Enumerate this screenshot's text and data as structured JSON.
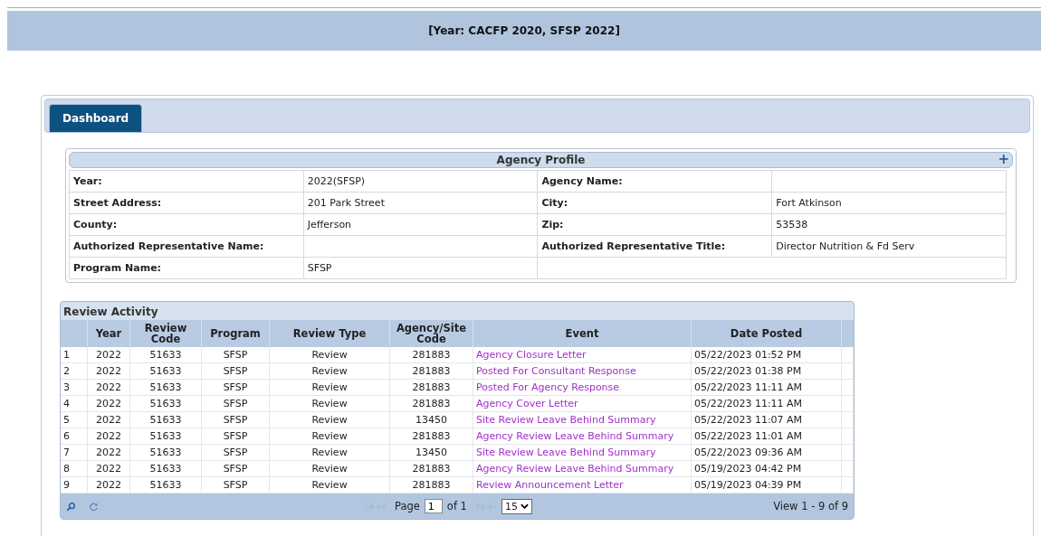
{
  "header": {
    "year_text": "[Year: CACFP 2020, SFSP 2022]"
  },
  "tabs": [
    {
      "label": "Dashboard",
      "selected": true
    }
  ],
  "agency_profile": {
    "title": "Agency Profile",
    "expand_icon": "+",
    "rows": [
      {
        "cells": [
          {
            "label": "Year:",
            "value": "2022(SFSP)"
          },
          {
            "label": "Agency Name:"
          }
        ]
      },
      {
        "cells": [
          {
            "label": "Street Address:",
            "value": "201 Park Street"
          },
          {
            "label": "City:",
            "value": "Fort Atkinson"
          }
        ]
      },
      {
        "cells": [
          {
            "label": "County:",
            "value": "Jefferson"
          },
          {
            "label": "Zip:",
            "value": "53538"
          }
        ]
      },
      {
        "cells": [
          {
            "label": "Authorized Representative Name:"
          },
          {
            "label": "Authorized Representative Title:",
            "value": "Director Nutrition & Fd Serv"
          }
        ]
      },
      {
        "cells": [
          {
            "label": "Program Name:",
            "value": "SFSP"
          }
        ]
      }
    ]
  },
  "review_activity": {
    "title": "Review Activity",
    "columns": [
      "",
      "Year",
      "Review Code",
      "Program",
      "Review Type",
      "Agency/Site Code",
      "Event",
      "Date Posted"
    ],
    "rows": [
      [
        "1",
        "2022",
        "51633",
        "SFSP",
        "Review",
        "281883",
        "Agency Closure Letter",
        "05/22/2023 01:52 PM"
      ],
      [
        "2",
        "2022",
        "51633",
        "SFSP",
        "Review",
        "281883",
        "Posted For Consultant Response",
        "05/22/2023 01:38 PM"
      ],
      [
        "3",
        "2022",
        "51633",
        "SFSP",
        "Review",
        "281883",
        "Posted For Agency Response",
        "05/22/2023 11:11 AM"
      ],
      [
        "4",
        "2022",
        "51633",
        "SFSP",
        "Review",
        "281883",
        "Agency Cover Letter",
        "05/22/2023 11:11 AM"
      ],
      [
        "5",
        "2022",
        "51633",
        "SFSP",
        "Review",
        "13450",
        "Site Review Leave Behind Summary",
        "05/22/2023 11:07 AM"
      ],
      [
        "6",
        "2022",
        "51633",
        "SFSP",
        "Review",
        "281883",
        "Agency Review Leave Behind Summary",
        "05/22/2023 11:01 AM"
      ],
      [
        "7",
        "2022",
        "51633",
        "SFSP",
        "Review",
        "13450",
        "Site Review Leave Behind Summary",
        "05/22/2023 09:36 AM"
      ],
      [
        "8",
        "2022",
        "51633",
        "SFSP",
        "Review",
        "281883",
        "Agency Review Leave Behind Summary",
        "05/19/2023 04:42 PM"
      ],
      [
        "9",
        "2022",
        "51633",
        "SFSP",
        "Review",
        "281883",
        "Review Announcement Letter",
        "05/19/2023 04:39 PM"
      ]
    ],
    "pager": {
      "page_label": "Page",
      "page": "1",
      "of_label": "of 1",
      "page_size": "15",
      "view_text": "View 1 - 9 of 9"
    }
  }
}
